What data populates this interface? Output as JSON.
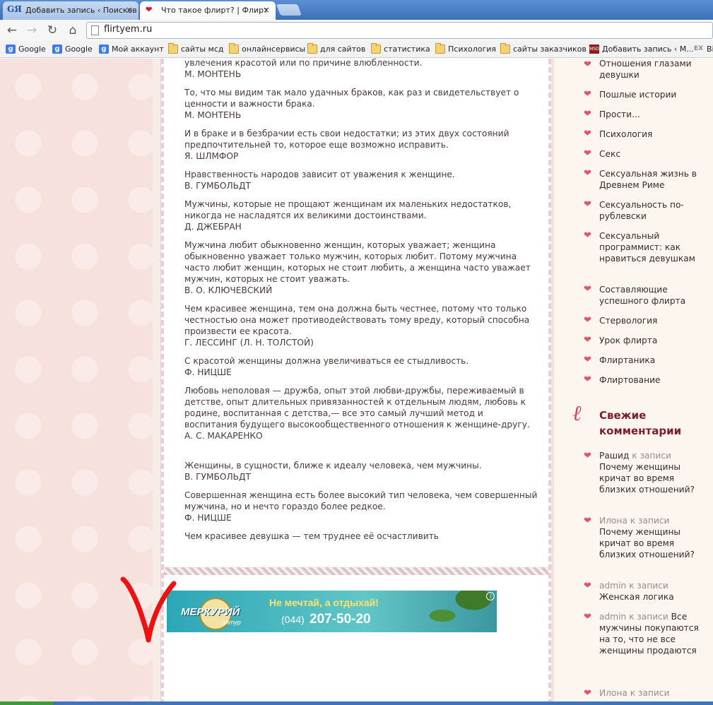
{
  "browser": {
    "tabs": [
      {
        "icon": "GЯ",
        "title": "Добавить запись ‹ Поисков",
        "active": false
      },
      {
        "icon": "❤",
        "title": "Что такое флирт? | Флирт",
        "active": true
      }
    ],
    "close_glyph": "×",
    "url": "flirtyem.ru",
    "nav": {
      "back": "←",
      "forward": "→",
      "reload": "↻",
      "home": "⌂"
    }
  },
  "bookmarks": [
    {
      "icon": "google-icon",
      "label": "Google"
    },
    {
      "icon": "google-icon",
      "label": "Google"
    },
    {
      "icon": "google-icon",
      "label": "Мой аккаунт"
    },
    {
      "icon": "folder-icon",
      "label": "сайты мсд"
    },
    {
      "icon": "folder-icon",
      "label": "онлайнсервисы"
    },
    {
      "icon": "folder-icon",
      "label": "для сайтов"
    },
    {
      "icon": "folder-icon",
      "label": "статистика"
    },
    {
      "icon": "folder-icon",
      "label": "Психология"
    },
    {
      "icon": "folder-icon",
      "label": "сайты заказчиков"
    },
    {
      "icon": "msd-icon",
      "label": "Добавить запись ‹ М..."
    },
    {
      "icon": "ex-icon",
      "label": "Ві"
    }
  ],
  "quotes": [
    {
      "text": "увлечения красотой или по причине влюбленности.",
      "author": "М. МОНТЕНЬ"
    },
    {
      "text": "То, что мы видим так мало удачных браков, как раз и свидетельствует о ценности и важности брака.",
      "author": "М. МОНТЕНЬ"
    },
    {
      "text": "И в браке и в безбрачии есть свои недостатки; из этих двух состояний предпочтительней то, которое еще возможно исправить.",
      "author": "Я. ШЛМФОР"
    },
    {
      "text": "Нравственность народов зависит от уважения к женщине.",
      "author": "В. ГУМБОЛЬДТ"
    },
    {
      "text": "Мужчины, которые не прощают женщинам их маленьких недостатков, никогда не насладятся их великими достоинствами.",
      "author": "Д. ДЖЕБРАН"
    },
    {
      "text": "Мужчина любит обыкновенно женщин, которых уважает; женщина обыкновенно уважает только мужчин, которых любит. Потому мужчина часто любит женщин, которых не стоит любить, а женщина часто уважает мужчин, которых не стоит уважать.",
      "author": "В. О. КЛЮЧЕВСКИЙ"
    },
    {
      "text": "Чем красивее женщина, тем она должна быть честнее, потому что только честностью она может противодействовать тому вреду, который способна произвести ее красота.",
      "author": "Г. ЛЕССИНГ (Л. Н. ТОЛСТОЙ)"
    },
    {
      "text": "С красотой женщины должна увеличиваться ее стыдливость.",
      "author": "Ф. НИЦШЕ"
    },
    {
      "text": "Любовь неполовая — дружба, опыт этой любви-дружбы, переживаемый в детстве, опыт длительных привязанностей к отдельным людям, любовь к родине, воспитанная с детства,— все это самый лучший метод и воспитания будущего высокообщественного отношения к женщине-другу.",
      "author": "А. С. МАКАРЕНКО"
    },
    {
      "text": "Женщины, в сущности, ближе к идеалу человека, чем мужчины.",
      "author": "В. ГУМБОЛЬДТ"
    },
    {
      "text": "Совершенная женщина есть более высокий тип человека, чем совершенный мужчина, но и нечто гораздо более редкое.",
      "author": "Ф. НИЦШЕ"
    },
    {
      "text": "Чем красивее девушка — тем труднее её осчастливить",
      "author": ""
    }
  ],
  "ad": {
    "brand": "МЕРКУРИЙ",
    "brand_sub": "интур",
    "slogan": "Не мечтай, а отдыхай!",
    "phone_code": "(044)",
    "phone_number": "207-50-20",
    "info_glyph": "i"
  },
  "sidebar": {
    "categories": [
      "Отношения глазами девушки",
      "Пошлые истории",
      "Прости...",
      "Психология",
      "Секс",
      "Сексуальная жизнь в Древнем Риме",
      "Сексуальность по-рублевски",
      "Сексуальный программист: как нравиться девушкам",
      "Составляющие успешного флирта",
      "Стервология",
      "Урок флирта",
      "Флиртаника",
      "Флиртование"
    ],
    "recent_comments_title": "Свежие комментарии",
    "recent_comments": [
      {
        "author": "Рашид",
        "connector": "к записи",
        "post": "Почему женщины кричат во время близких отношений?"
      },
      {
        "author": "Илона",
        "connector": "к записи",
        "post": "Почему женщины кричат во время близких отношений?"
      },
      {
        "author": "admin",
        "connector": "к записи",
        "post": "Женская логика"
      },
      {
        "author": "admin",
        "connector": "к записи",
        "post": "Все мужчины покупаются на то, что не все женщины продаются"
      },
      {
        "author": "Илона",
        "connector": "к записи",
        "post": ""
      }
    ]
  },
  "colors": {
    "accent": "#e2536b",
    "heading": "#7c1c2c",
    "page_bg": "#f7e1dc"
  }
}
